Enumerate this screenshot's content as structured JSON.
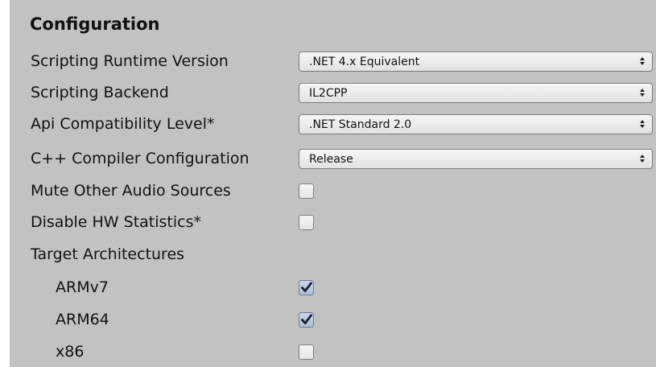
{
  "section": {
    "title": "Configuration"
  },
  "settings": {
    "scripting_runtime": {
      "label": "Scripting Runtime Version",
      "value": ".NET 4.x Equivalent"
    },
    "scripting_backend": {
      "label": "Scripting Backend",
      "value": "IL2CPP"
    },
    "api_compatibility": {
      "label": "Api Compatibility Level*",
      "value": ".NET Standard 2.0"
    },
    "cpp_compiler": {
      "label": "C++ Compiler Configuration",
      "value": "Release"
    },
    "mute_audio": {
      "label": "Mute Other Audio Sources",
      "checked": false
    },
    "disable_hw_stats": {
      "label": "Disable HW Statistics*",
      "checked": false
    },
    "target_architectures": {
      "label": "Target Architectures",
      "items": [
        {
          "label": "ARMv7",
          "checked": true
        },
        {
          "label": "ARM64",
          "checked": true
        },
        {
          "label": "x86",
          "checked": false
        }
      ]
    }
  },
  "icons": {
    "dropdown": "up-down-arrows-icon",
    "check": "checkmark-icon"
  },
  "colors": {
    "panel_background": "#c2c2c2",
    "checkbox_checked": "#aabfdc",
    "checkmark": "#1a1f2a"
  }
}
